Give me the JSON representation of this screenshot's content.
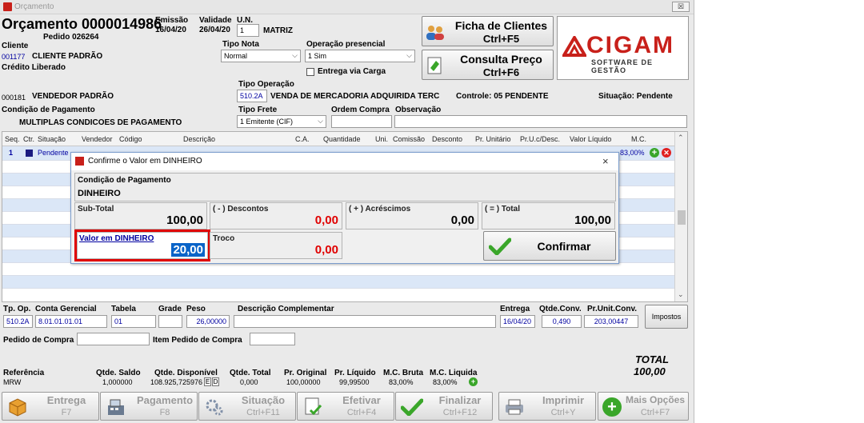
{
  "window": {
    "title": "Orçamento",
    "close_glyph": "☒"
  },
  "header": {
    "orcamento": "Orçamento 0000014986",
    "pedido": "Pedido 026264",
    "emissao_label": "Emissão",
    "emissao_value": "16/04/20",
    "validade_label": "Validade",
    "validade_value": "26/04/20",
    "un_label": "U.N.",
    "un_value": "1",
    "un_name": "MATRIZ",
    "cliente_label": "Cliente",
    "cliente_code": "001177",
    "cliente_name": "CLIENTE PADRÃO",
    "credito": "Crédito Liberado",
    "tipo_nota_label": "Tipo Nota",
    "tipo_nota_value": "Normal",
    "op_presencial_label": "Operação presencial",
    "op_presencial_value": "1 Sim",
    "entrega_via_carga": "Entrega via Carga",
    "tipo_operacao_label": "Tipo Operação",
    "tipo_operacao_code": "510.2A",
    "tipo_operacao_desc": "VENDA DE MERCADORIA ADQUIRIDA TERC",
    "vendedor_code": "000181",
    "vendedor_name": "VENDEDOR PADRÃO",
    "controle": "Controle: 05  PENDENTE",
    "situacao": "Situação: Pendente",
    "cond_pag_label": "Condição de Pagamento",
    "cond_pag_value": "MULTIPLAS CONDICOES DE PAGAMENTO",
    "tipo_frete_label": "Tipo Frete",
    "tipo_frete_value": "1 Emitente (CIF)",
    "ordem_compra_label": "Ordem Compra",
    "observacao_label": "Observação"
  },
  "buttons": {
    "ficha_l1": "Ficha de Clientes",
    "ficha_l2": "Ctrl+F5",
    "consulta_l1": "Consulta Preço",
    "consulta_l2": "Ctrl+F6"
  },
  "logo": {
    "name": "CIGAM",
    "tagline": "SOFTWARE DE GESTÃO"
  },
  "grid": {
    "columns": [
      "Seq.",
      "Ctr.",
      "Situação",
      "Vendedor",
      "Código",
      "Descrição",
      "C.A.",
      "Quantidade",
      "Uni.",
      "Comissão",
      "Desconto",
      "Pr. Unitário",
      "Pr.U.c/Desc.",
      "Valor Líquido",
      "M.C."
    ],
    "row1": {
      "seq": "1",
      "situacao": "Pendente",
      "mc": "83,00%"
    }
  },
  "dialog": {
    "title": "Confirme o Valor em DINHEIRO",
    "cond_label": "Condição de Pagamento",
    "cond_value": "DINHEIRO",
    "subtotal_label": "Sub-Total",
    "subtotal_value": "100,00",
    "descontos_label": "( - ) Descontos",
    "descontos_value": "0,00",
    "acrescimos_label": "( + ) Acréscimos",
    "acrescimos_value": "0,00",
    "total_label": "( = ) Total",
    "total_value": "100,00",
    "valor_label": "Valor em DINHEIRO",
    "valor_value": "20,00",
    "troco_label": "Troco",
    "troco_value": "0,00",
    "confirmar": "Confirmar"
  },
  "lower": {
    "tp_op_label": "Tp. Op.",
    "tp_op_value": "510.2A",
    "conta_label": "Conta Gerencial",
    "conta_value": "8.01.01.01.01",
    "tabela_label": "Tabela",
    "tabela_value": "01",
    "grade_label": "Grade",
    "peso_label": "Peso",
    "peso_value": "26,00000",
    "desc_comp_label": "Descrição Complementar",
    "entrega_label": "Entrega",
    "entrega_value": "16/04/20",
    "qtde_conv_label": "Qtde.Conv.",
    "qtde_conv_value": "0,490",
    "pr_unit_conv_label": "Pr.Unit.Conv.",
    "pr_unit_conv_value": "203,00447",
    "impostos": "Impostos",
    "pedido_compra_label": "Pedido de Compra",
    "item_pedido_label": "Item Pedido de Compra",
    "total_label": "TOTAL",
    "total_value": "100,00",
    "referencia_label": "Referência",
    "referencia_value": "MRW",
    "qtde_saldo_label": "Qtde. Saldo",
    "qtde_saldo_value": "1,000000",
    "qtde_disp_label": "Qtde. Disponível",
    "qtde_disp_value": "108.925,725976",
    "qtde_total_label": "Qtde. Total",
    "qtde_total_value": "0,000",
    "pr_original_label": "Pr. Original",
    "pr_original_value": "100,00000",
    "pr_liquido_label": "Pr. Líquido",
    "pr_liquido_value": "99,99500",
    "mc_bruta_label": "M.C. Bruta",
    "mc_bruta_value": "83,00%",
    "mc_liquida_label": "M.C. Liquida",
    "mc_liquida_value": "83,00%"
  },
  "footer": [
    {
      "l1": "Entrega",
      "l2": "F7",
      "icon": "box-icon"
    },
    {
      "l1": "Pagamento",
      "l2": "F8",
      "icon": "cash-register-icon"
    },
    {
      "l1": "Situação",
      "l2": "Ctrl+F11",
      "icon": "gears-icon"
    },
    {
      "l1": "Efetivar",
      "l2": "Ctrl+F4",
      "icon": "document-check-icon"
    },
    {
      "l1": "Finalizar",
      "l2": "Ctrl+F12",
      "icon": "checkmark-icon"
    },
    {
      "l1": "Imprimir",
      "l2": "Ctrl+Y",
      "icon": "printer-icon"
    },
    {
      "l1": "Mais Opções",
      "l2": "Ctrl+F7",
      "icon": "plus-icon"
    }
  ],
  "colors": {
    "accent_blue": "#0000a0",
    "value_red": "#e00000",
    "highlight_red": "#e00000",
    "select_blue": "#0a64c8",
    "check_green": "#3aa62a"
  }
}
